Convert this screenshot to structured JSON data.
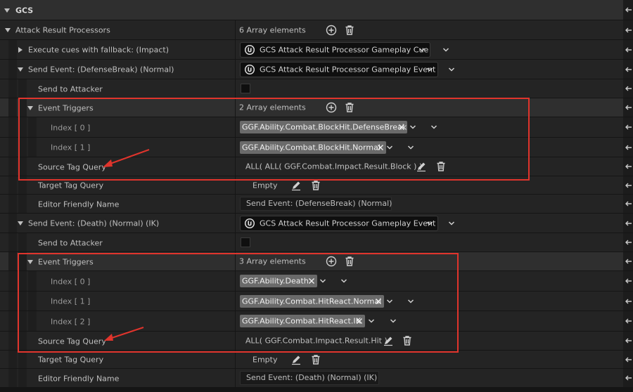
{
  "section": {
    "title": "GCS"
  },
  "rows": {
    "attack_result_processors": {
      "label": "Attack Result Processors",
      "value": "6 Array elements"
    },
    "execute_cues": {
      "label": "Execute cues with fallback: (Impact)",
      "combo": "GCS Attack Result Processor Gameplay Cue"
    },
    "send_event_defensebreak": {
      "label": "Send Event: (DefenseBreak)  (Normal)",
      "combo": "GCS Attack Result Processor Gameplay Event"
    },
    "send_to_attacker_1": {
      "label": "Send to Attacker"
    },
    "event_triggers_1": {
      "label": "Event Triggers",
      "value": "2 Array elements"
    },
    "index_1_0": {
      "label": "Index [ 0 ]",
      "tag": "GGF.Ability.Combat.BlockHit.DefenseBreak"
    },
    "index_1_1": {
      "label": "Index [ 1 ]",
      "tag": "GGF.Ability.Combat.BlockHit.Normal"
    },
    "source_tag_query_1": {
      "label": "Source Tag Query",
      "value": "ALL(  ALL( GGF.Combat.Impact.Result.Block ) )"
    },
    "target_tag_query_1": {
      "label": "Target Tag Query",
      "value": "Empty"
    },
    "editor_friendly_name_1": {
      "label": "Editor Friendly Name",
      "value": "Send Event: (DefenseBreak)  (Normal)"
    },
    "send_event_death": {
      "label": "Send Event: (Death)  (Normal)  (IK)",
      "combo": "GCS Attack Result Processor Gameplay Event"
    },
    "send_to_attacker_2": {
      "label": "Send to Attacker"
    },
    "event_triggers_2": {
      "label": "Event Triggers",
      "value": "3 Array elements"
    },
    "index_2_0": {
      "label": "Index [ 0 ]",
      "tag": "GGF.Ability.Death"
    },
    "index_2_1": {
      "label": "Index [ 1 ]",
      "tag": "GGF.Ability.Combat.HitReact.Normal"
    },
    "index_2_2": {
      "label": "Index [ 2 ]",
      "tag": "GGF.Ability.Combat.HitReact.IK"
    },
    "source_tag_query_2": {
      "label": "Source Tag Query",
      "value": "ALL( GGF.Combat.Impact.Result.Hit )"
    },
    "target_tag_query_2": {
      "label": "Target Tag Query",
      "value": "Empty"
    },
    "editor_friendly_name_2": {
      "label": "Editor Friendly Name",
      "value": "Send Event: (Death)  (Normal)  (IK)"
    }
  },
  "icons": {
    "add": "plus-circle-icon",
    "delete": "trash-icon",
    "edit": "pencil-icon",
    "reset": "reset-arrow-icon",
    "class": "unreal-class-icon",
    "clear": "x-icon",
    "dropdown": "chevron-down-icon"
  },
  "colors": {
    "highlight": "#e0342c",
    "chip": "#6a6a6a",
    "background": "#242424"
  }
}
